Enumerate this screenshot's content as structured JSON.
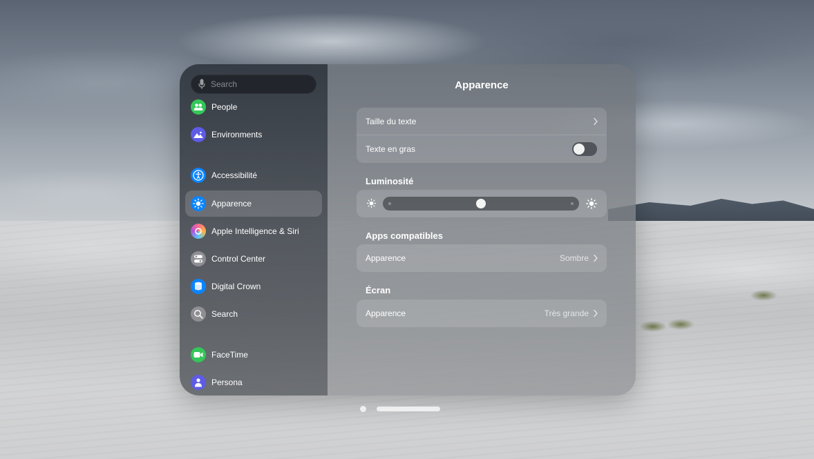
{
  "search": {
    "placeholder": "Search"
  },
  "sidebar": {
    "items": [
      {
        "label": "People",
        "icon": "people-icon",
        "color": "#34c759"
      },
      {
        "label": "Environments",
        "icon": "mountain-icon",
        "color": "#5e5ce6"
      },
      {
        "label": "Accessibilité",
        "icon": "accessibility-icon",
        "color": "#0a84ff"
      },
      {
        "label": "Apparence",
        "icon": "sun-icon",
        "color": "#0a84ff",
        "selected": true
      },
      {
        "label": "Apple Intelligence & Siri",
        "icon": "siri-icon",
        "color": "#ff6b8a"
      },
      {
        "label": "Control Center",
        "icon": "toggles-icon",
        "color": "#8e8e93"
      },
      {
        "label": "Digital Crown",
        "icon": "crown-icon",
        "color": "#0a84ff"
      },
      {
        "label": "Search",
        "icon": "magnifier-icon",
        "color": "#8e8e93"
      },
      {
        "label": "FaceTime",
        "icon": "video-icon",
        "color": "#34c759"
      },
      {
        "label": "Persona",
        "icon": "persona-icon",
        "color": "#5e5ce6"
      }
    ]
  },
  "main": {
    "title": "Apparence",
    "text_group": {
      "text_size_label": "Taille du texte",
      "bold_label": "Texte en gras",
      "bold_on": false
    },
    "brightness": {
      "heading": "Luminosité",
      "level": 0.5
    },
    "apps": {
      "heading": "Apps compatibles",
      "label": "Apparence",
      "value": "Sombre"
    },
    "screen": {
      "heading": "Écran",
      "label": "Apparence",
      "value": "Très grande"
    }
  }
}
